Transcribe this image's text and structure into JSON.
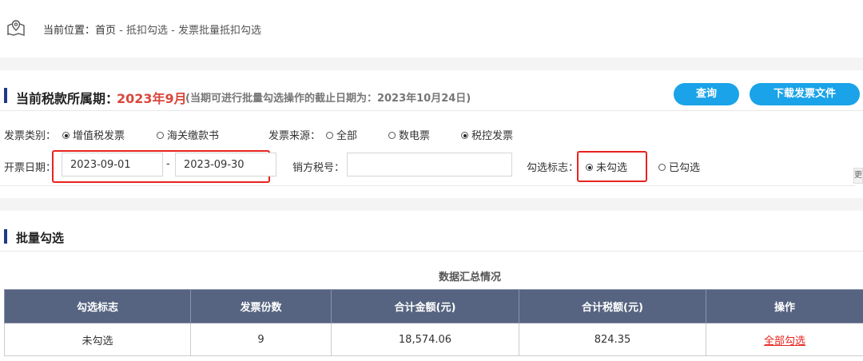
{
  "breadcrumb": {
    "prefix": "当前位置：",
    "items": [
      "首页",
      "抵扣勾选",
      "发票批量抵扣勾选"
    ],
    "separator": " - "
  },
  "header": {
    "period_label": "当前税款所属期：",
    "period_value": "2023年9月",
    "period_note": "(当期可进行批量勾选操作的截止日期为：2023年10月24日)",
    "query_button": "查询",
    "download_button": "下载发票文件"
  },
  "filters": {
    "invoice_type_label": "发票类别：",
    "invoice_type_options": [
      {
        "label": "增值税发票",
        "selected": true
      },
      {
        "label": "海关缴款书",
        "selected": false
      }
    ],
    "invoice_source_label": "发票来源：",
    "invoice_source_options": [
      {
        "label": "全部",
        "selected": false
      },
      {
        "label": "数电票",
        "selected": false
      },
      {
        "label": "税控发票",
        "selected": true
      }
    ],
    "date_label": "开票日期：",
    "date_from": "2023-09-01",
    "date_sep": "-",
    "date_to": "2023-09-30",
    "seller_tax_label": "销方税号：",
    "seller_tax_value": "",
    "check_flag_label": "勾选标志：",
    "check_flag_options": [
      {
        "label": "未勾选",
        "selected": true
      },
      {
        "label": "已勾选",
        "selected": false
      }
    ],
    "side_tab": "更"
  },
  "batch": {
    "section_title": "批量勾选",
    "summary_title": "数据汇总情况",
    "columns": [
      "勾选标志",
      "发票份数",
      "合计金额(元)",
      "合计税额(元)",
      "操作"
    ],
    "rows": [
      {
        "flag": "未勾选",
        "count": "9",
        "amount": "18,574.06",
        "tax": "824.35",
        "action": "全部勾选"
      }
    ]
  },
  "colors": {
    "accent_blue": "#1aa3e8",
    "period_red": "#d9473c",
    "highlight_red": "#e8231e",
    "table_header": "#566481",
    "section_mark": "#1e3a8a"
  }
}
